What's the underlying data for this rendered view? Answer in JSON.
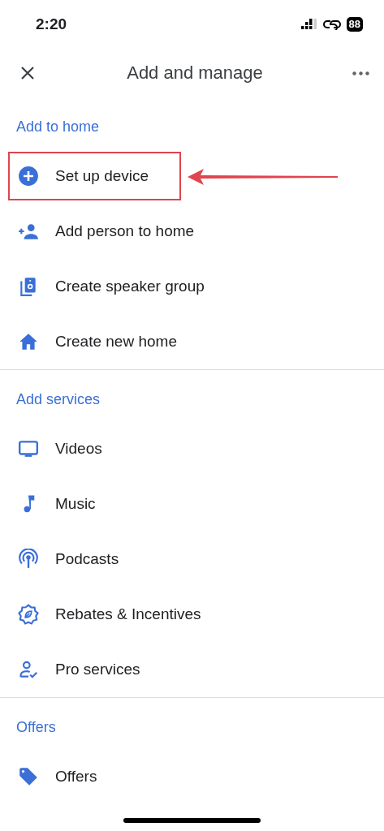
{
  "status_bar": {
    "time": "2:20",
    "battery": "88"
  },
  "header": {
    "title": "Add and manage"
  },
  "sections": [
    {
      "title": "Add to home",
      "items": [
        {
          "label": "Set up device",
          "kind": "add-circle",
          "highlighted": true
        },
        {
          "label": "Add person to home",
          "kind": "add-person",
          "highlighted": false
        },
        {
          "label": "Create speaker group",
          "kind": "speaker",
          "highlighted": false
        },
        {
          "label": "Create new home",
          "kind": "house",
          "highlighted": false
        }
      ]
    },
    {
      "title": "Add services",
      "items": [
        {
          "label": "Videos",
          "kind": "tv",
          "highlighted": false
        },
        {
          "label": "Music",
          "kind": "note",
          "highlighted": false
        },
        {
          "label": "Podcasts",
          "kind": "podcast",
          "highlighted": false
        },
        {
          "label": "Rebates & Incentives",
          "kind": "badge-leaf",
          "highlighted": false
        },
        {
          "label": "Pro services",
          "kind": "person-check",
          "highlighted": false
        }
      ]
    },
    {
      "title": "Offers",
      "items": [
        {
          "label": "Offers",
          "kind": "tag",
          "highlighted": false
        }
      ]
    }
  ]
}
